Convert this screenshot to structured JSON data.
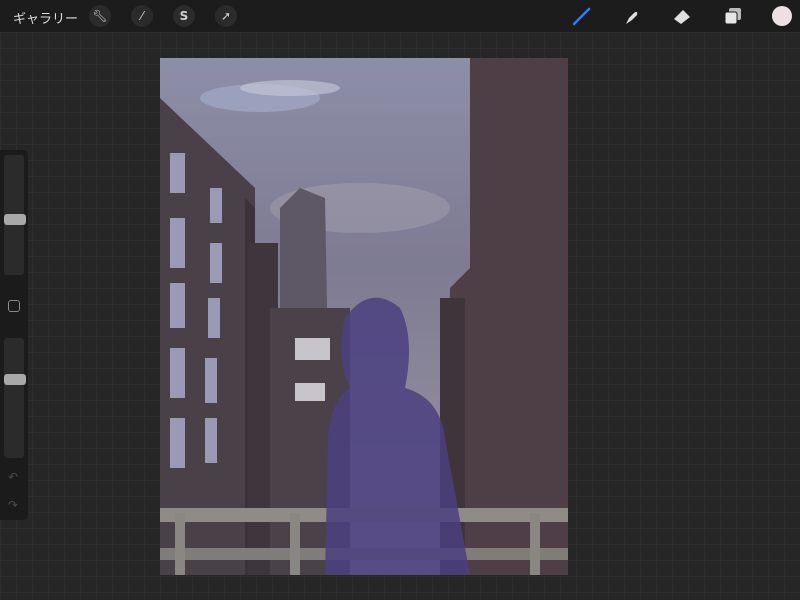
{
  "topbar": {
    "gallery_label": "ギャラリー",
    "actions_icon": "wrench-icon",
    "adjustments_icon": "magic-wand-icon",
    "selection_icon": "selection-s-icon",
    "transform_icon": "arrow-cursor-icon"
  },
  "tools": {
    "brush_icon": "brush-icon",
    "smudge_icon": "smudge-icon",
    "eraser_icon": "eraser-icon",
    "layers_icon": "layers-icon",
    "active_tool": "brush",
    "active_color": "#ece0e3",
    "accent": "#2f7bf5"
  },
  "sidebar": {
    "brush_size": 0.46,
    "opacity": 0.67,
    "modify_icon": "square-icon",
    "undo_icon": "undo-icon",
    "redo_icon": "redo-icon"
  }
}
